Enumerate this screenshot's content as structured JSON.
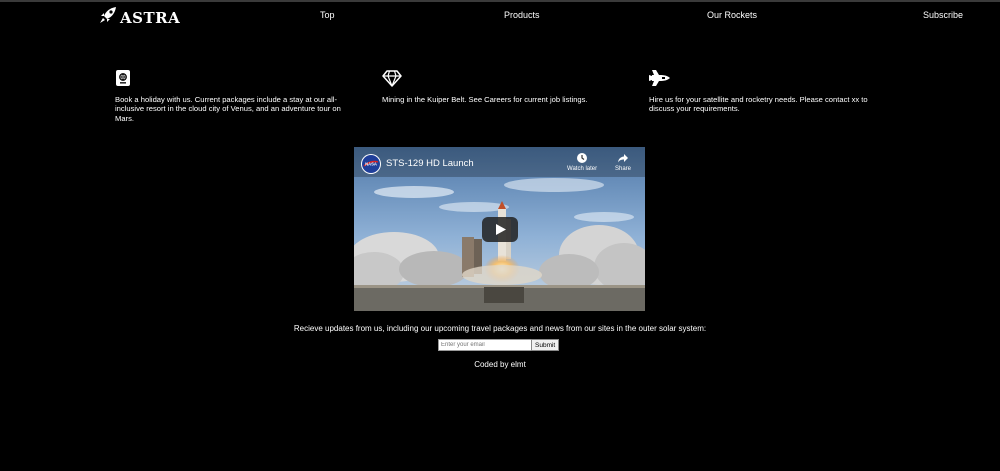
{
  "brand": {
    "name": "ASTRA",
    "logo_icon": "rocket-icon"
  },
  "nav": {
    "items": [
      "Top",
      "Products",
      "Our Rockets",
      "Subscribe"
    ]
  },
  "features": [
    {
      "icon": "passport-icon",
      "text": "Book a holiday with us. Current packages include a stay at our all-inclusive resort in the cloud city of Venus, and an adventure tour on Mars."
    },
    {
      "icon": "diamond-icon",
      "text": "Mining in the Kuiper Belt. See Careers for current job listings."
    },
    {
      "icon": "space-shuttle-icon",
      "text": "Hire us for your satellite and rocketry needs. Please contact xx to discuss your requirements."
    }
  ],
  "video": {
    "title": "STS-129 HD Launch",
    "watch_later_label": "Watch later",
    "share_label": "Share"
  },
  "subscribe": {
    "text": "Recieve updates from us, including our upcoming travel packages and news from our sites in the outer solar system:",
    "placeholder": "Enter your email",
    "submit_label": "Submit"
  },
  "footer": {
    "credit": "Coded by elmt"
  },
  "colors": {
    "background": "#000000",
    "text": "#ffffff",
    "topbar_line": "#3a3a3a"
  }
}
